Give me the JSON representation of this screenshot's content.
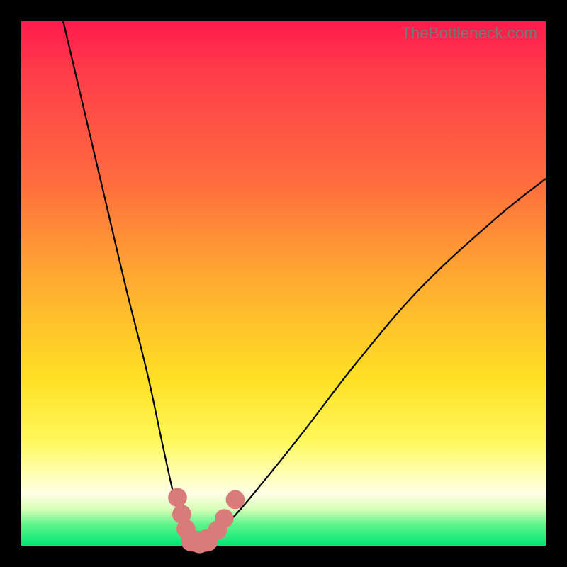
{
  "watermark": "TheBottleneck.com",
  "colors": {
    "frame": "#000000",
    "curve": "#000000",
    "bead": "#d97b7b",
    "gradient_top": "#ff1a4d",
    "gradient_bottom": "#00e676"
  },
  "chart_data": {
    "type": "line",
    "title": "",
    "xlabel": "",
    "ylabel": "",
    "xlim": [
      0,
      100
    ],
    "ylim": [
      0,
      100
    ],
    "note": "V-shaped bottleneck curve on rainbow gradient; minimum near x≈33, pink beads mark points near the trough.",
    "series": [
      {
        "name": "left-branch",
        "x": [
          8,
          12,
          16,
          20,
          24,
          27,
          29,
          30.5,
          31.8,
          33
        ],
        "y": [
          100,
          83,
          66,
          49,
          33,
          19,
          10,
          5,
          2,
          0
        ]
      },
      {
        "name": "right-branch",
        "x": [
          33,
          36,
          40,
          46,
          54,
          64,
          76,
          90,
          100
        ],
        "y": [
          0,
          2,
          5,
          12,
          22,
          35,
          49,
          62,
          70
        ]
      }
    ],
    "markers": [
      {
        "x": 29.8,
        "y": 9.2,
        "r": 1.8
      },
      {
        "x": 30.6,
        "y": 6.0,
        "r": 1.8
      },
      {
        "x": 31.4,
        "y": 3.2,
        "r": 1.8
      },
      {
        "x": 32.5,
        "y": 1.0,
        "r": 2.4
      },
      {
        "x": 34.0,
        "y": 0.7,
        "r": 2.4
      },
      {
        "x": 35.4,
        "y": 1.0,
        "r": 2.4
      },
      {
        "x": 37.4,
        "y": 3.0,
        "r": 1.8
      },
      {
        "x": 38.7,
        "y": 5.2,
        "r": 1.8
      },
      {
        "x": 40.8,
        "y": 8.8,
        "r": 1.8
      }
    ]
  }
}
